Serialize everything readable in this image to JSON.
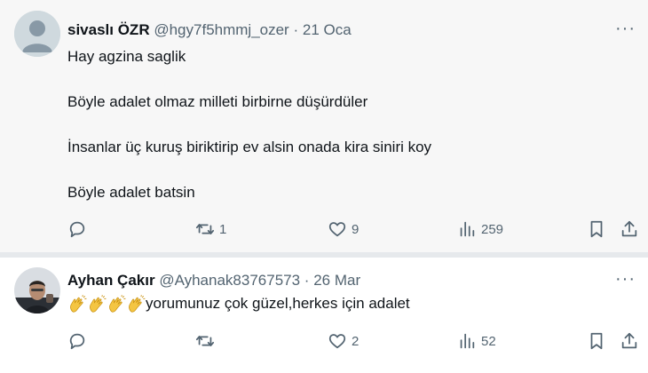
{
  "tweets": [
    {
      "author": "sivaslı ÖZR",
      "handle": "@hgy7f5hmmj_ozer",
      "date": "21 Oca",
      "dot": "·",
      "more": "···",
      "lines": [
        "Hay agzina saglik",
        "Böyle adalet olmaz milleti birbirne düşürdüler",
        "İnsanlar üç kuruş biriktirip ev alsin onada kira siniri koy",
        "Böyle adalet batsin"
      ],
      "replies": "",
      "retweets": "1",
      "likes": "9",
      "views": "259"
    },
    {
      "author": "Ayhan Çakır",
      "handle": "@Ayhanak83767573",
      "date": "26 Mar",
      "dot": "·",
      "more": "···",
      "emoji_count": 4,
      "emoji_name": "clapping-hands",
      "text": "yorumunuz çok güzel,herkes için adalet",
      "replies": "",
      "retweets": "",
      "likes": "2",
      "views": "52"
    }
  ],
  "colors": {
    "secondary_text": "#536471",
    "primary_text": "#0f1419",
    "highlight_bg": "#f7f7f7"
  }
}
